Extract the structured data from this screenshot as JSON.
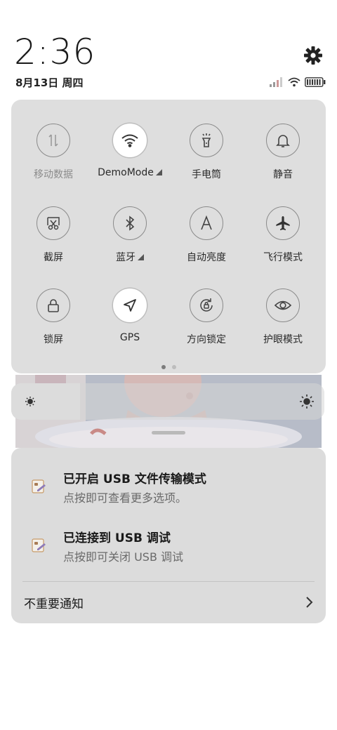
{
  "status": {
    "time": "2:36",
    "date": "8月13日 周四"
  },
  "icons": {
    "settings": "gear-icon",
    "signal": "signal-icon",
    "wifi": "wifi-icon",
    "battery": "battery-icon"
  },
  "tiles": [
    {
      "label": "移动数据",
      "icon": "data-arrows-icon",
      "active": false,
      "dim": true,
      "more": false
    },
    {
      "label": "DemoMode",
      "icon": "wifi-icon",
      "active": true,
      "dim": false,
      "more": true
    },
    {
      "label": "手电筒",
      "icon": "flashlight-icon",
      "active": false,
      "dim": false,
      "more": false
    },
    {
      "label": "静音",
      "icon": "bell-icon",
      "active": false,
      "dim": false,
      "more": false
    },
    {
      "label": "截屏",
      "icon": "scissors-icon",
      "active": false,
      "dim": false,
      "more": false
    },
    {
      "label": "蓝牙",
      "icon": "bluetooth-icon",
      "active": false,
      "dim": false,
      "more": true
    },
    {
      "label": "自动亮度",
      "icon": "letter-a-icon",
      "active": false,
      "dim": false,
      "more": false
    },
    {
      "label": "飞行模式",
      "icon": "airplane-icon",
      "active": false,
      "dim": false,
      "more": false
    },
    {
      "label": "锁屏",
      "icon": "lock-icon",
      "active": false,
      "dim": false,
      "more": false
    },
    {
      "label": "GPS",
      "icon": "location-arrow-icon",
      "active": true,
      "dim": false,
      "more": false
    },
    {
      "label": "方向锁定",
      "icon": "rotation-lock-icon",
      "active": false,
      "dim": false,
      "more": false
    },
    {
      "label": "护眼模式",
      "icon": "eye-icon",
      "active": false,
      "dim": false,
      "more": false
    }
  ],
  "pager": {
    "pages": 2,
    "current": 1
  },
  "brightness": {
    "level": 0.22
  },
  "notifications": [
    {
      "title": "已开启 USB 文件传输模式",
      "subtitle": "点按即可查看更多选项。"
    },
    {
      "title": "已连接到 USB 调试",
      "subtitle": "点按即可关闭 USB 调试"
    }
  ],
  "unimportant": {
    "label": "不重要通知"
  }
}
